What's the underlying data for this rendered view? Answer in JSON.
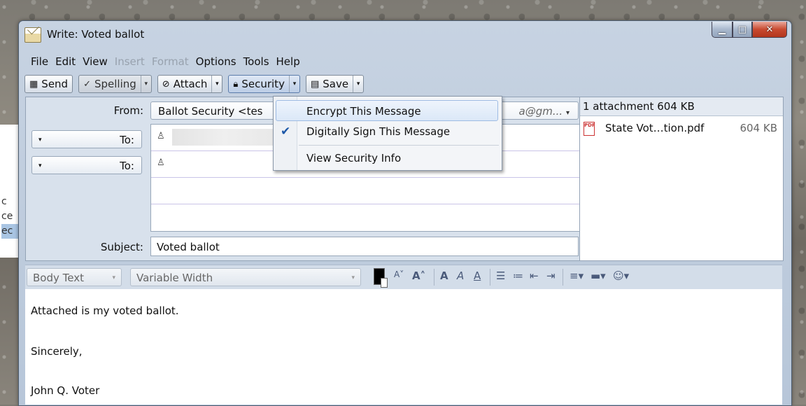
{
  "window": {
    "title": "Write: Voted ballot"
  },
  "behind_window": {
    "lines": [
      "c",
      "ce",
      "ec"
    ]
  },
  "menubar": {
    "items": [
      {
        "label": "File",
        "enabled": true
      },
      {
        "label": "Edit",
        "enabled": true
      },
      {
        "label": "View",
        "enabled": true
      },
      {
        "label": "Insert",
        "enabled": false
      },
      {
        "label": "Format",
        "enabled": false
      },
      {
        "label": "Options",
        "enabled": true
      },
      {
        "label": "Tools",
        "enabled": true
      },
      {
        "label": "Help",
        "enabled": true
      }
    ]
  },
  "toolbar": {
    "send": "Send",
    "spelling": "Spelling",
    "attach": "Attach",
    "security": "Security",
    "save": "Save"
  },
  "header": {
    "from_label": "From:",
    "from_value": "Ballot Security <tes",
    "from_tail": "a@gm...",
    "to_label": "To:",
    "subject_label": "Subject:",
    "subject_value": "Voted ballot"
  },
  "attachments": {
    "summary": "1 attachment 604 KB",
    "items": [
      {
        "name": "State Vot…tion.pdf",
        "size": "604 KB"
      }
    ]
  },
  "format_bar": {
    "paragraph_style": "Body Text",
    "font": "Variable Width"
  },
  "body": {
    "lines": [
      "Attached is my voted ballot.",
      "Sincerely,",
      "John Q. Voter"
    ]
  },
  "security_menu": {
    "items": [
      {
        "label": "Encrypt This Message",
        "highlighted": true,
        "checked": false
      },
      {
        "label": "Digitally Sign This Message",
        "highlighted": false,
        "checked": true
      },
      {
        "label": "View Security Info",
        "highlighted": false,
        "checked": false
      }
    ]
  },
  "colors": {
    "accent": "#1d58a8",
    "window_frame": "#b7c6d9",
    "close_button": "#c84a30"
  }
}
